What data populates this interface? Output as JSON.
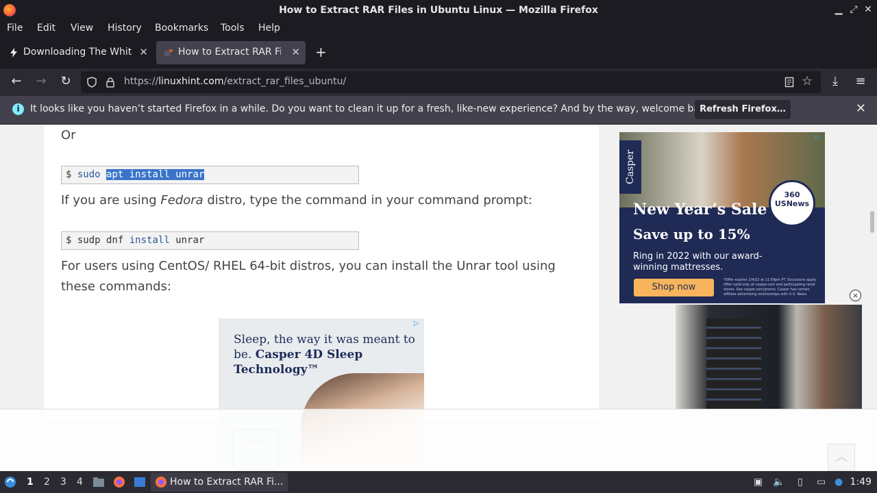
{
  "window": {
    "title": "How to Extract RAR Files in Ubuntu Linux — Mozilla Firefox",
    "minimize_icon": "minimize-icon",
    "maximize_icon": "restore-icon",
    "close_icon": "close-icon"
  },
  "menu": [
    "File",
    "Edit",
    "View",
    "History",
    "Bookmarks",
    "Tools",
    "Help"
  ],
  "tabs": [
    {
      "label": "Downloading The White House",
      "active": false
    },
    {
      "label": "How to Extract RAR Files in Ubuntu Linux",
      "active": true
    }
  ],
  "new_tab_label": "+",
  "nav": {
    "url_prefix": "https://",
    "url_host": "linuxhint.com",
    "url_path": "/extract_rar_files_ubuntu/"
  },
  "notification": {
    "message": "It looks like you haven’t started Firefox in a while. Do you want to clean it up for a fresh, like-new experience? And by the way, welcome back!",
    "button": "Refresh Firefox…",
    "info_glyph": "i",
    "close_glyph": "✕"
  },
  "article": {
    "or_text": "Or",
    "cmd1": {
      "prompt": "$",
      "word1": "sudo",
      "selected": "apt install unrar"
    },
    "fedora_pre": "If you are using ",
    "fedora_em": "Fedora",
    "fedora_post": " distro, type the command in your command prompt:",
    "cmd2": {
      "prompt": "$",
      "word1": "sudp dnf",
      "kw": "install",
      "word3": "unrar"
    },
    "centos_text": "For users using CentOS/ RHEL 64-bit distros, you can install the Unrar tool using these commands:"
  },
  "ad_center": {
    "line1": "Sleep, the way it was meant to be. ",
    "line2": "Casper 4D Sleep Technology™",
    "badge": "4D"
  },
  "ad_right": {
    "brand": "Casper",
    "badge": "360 USNews",
    "heading": "New Year’s Sale",
    "subheading": "Save up to 15%",
    "body": "Ring in 2022 with our award-winning mattresses.",
    "cta": "Shop now",
    "fine_print": "*Offer expires 1/4/22 at 11:59pm PT. Exclusions apply. Offer valid only at casper.com and participating retail stores. See casper.com/promo. Casper has certain affiliate advertising relationships with U.S. News."
  },
  "taskbar": {
    "workspaces": [
      "1",
      "2",
      "3",
      "4"
    ],
    "active_workspace": "1",
    "task_label": "How to Extract RAR Fi...",
    "clock": "1:49"
  },
  "colors": {
    "chrome_bg": "#1c1b22",
    "toolbar_bg": "#2b2a33",
    "accent_selection": "#3a74c9",
    "ad_navy": "#1f2a55",
    "cta_orange": "#f7b45c"
  }
}
